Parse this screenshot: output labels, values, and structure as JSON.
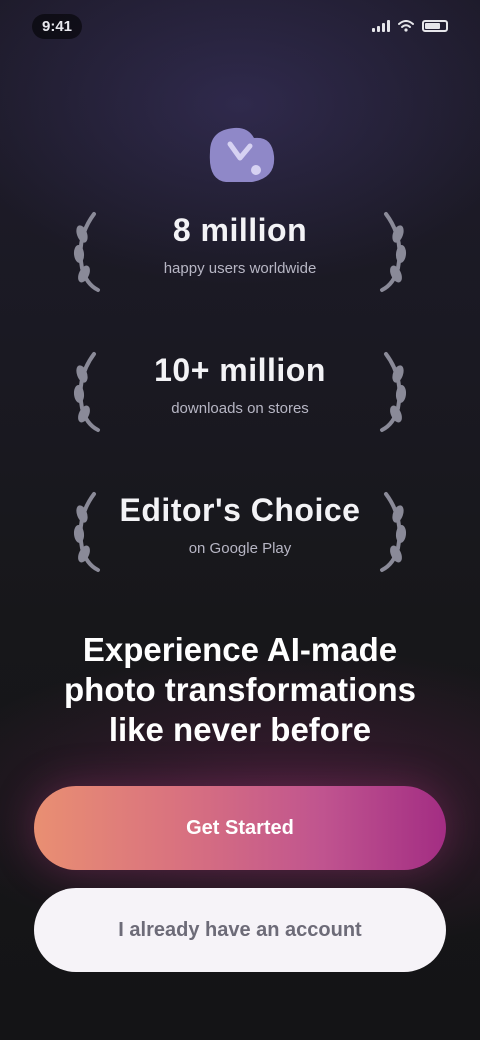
{
  "status_bar": {
    "time": "9:41"
  },
  "logo": {
    "icon": "app-logo-icon",
    "color": "#8f88c8"
  },
  "stats": [
    {
      "value": "8 million",
      "caption": "happy users worldwide",
      "icon": "laurel-icon"
    },
    {
      "value": "10+ million",
      "caption": "downloads on stores",
      "icon": "laurel-icon"
    },
    {
      "value": "Editor's Choice",
      "caption": "on Google Play",
      "icon": "laurel-icon"
    }
  ],
  "headline": "Experience AI-made photo transformations like never before",
  "buttons": {
    "primary_label": "Get Started",
    "secondary_label": "I already have an account"
  },
  "colors": {
    "background": "#17171a",
    "accent_start": "#e98f72",
    "accent_end": "#a32d83",
    "secondary_button": "#f6f3f8"
  }
}
